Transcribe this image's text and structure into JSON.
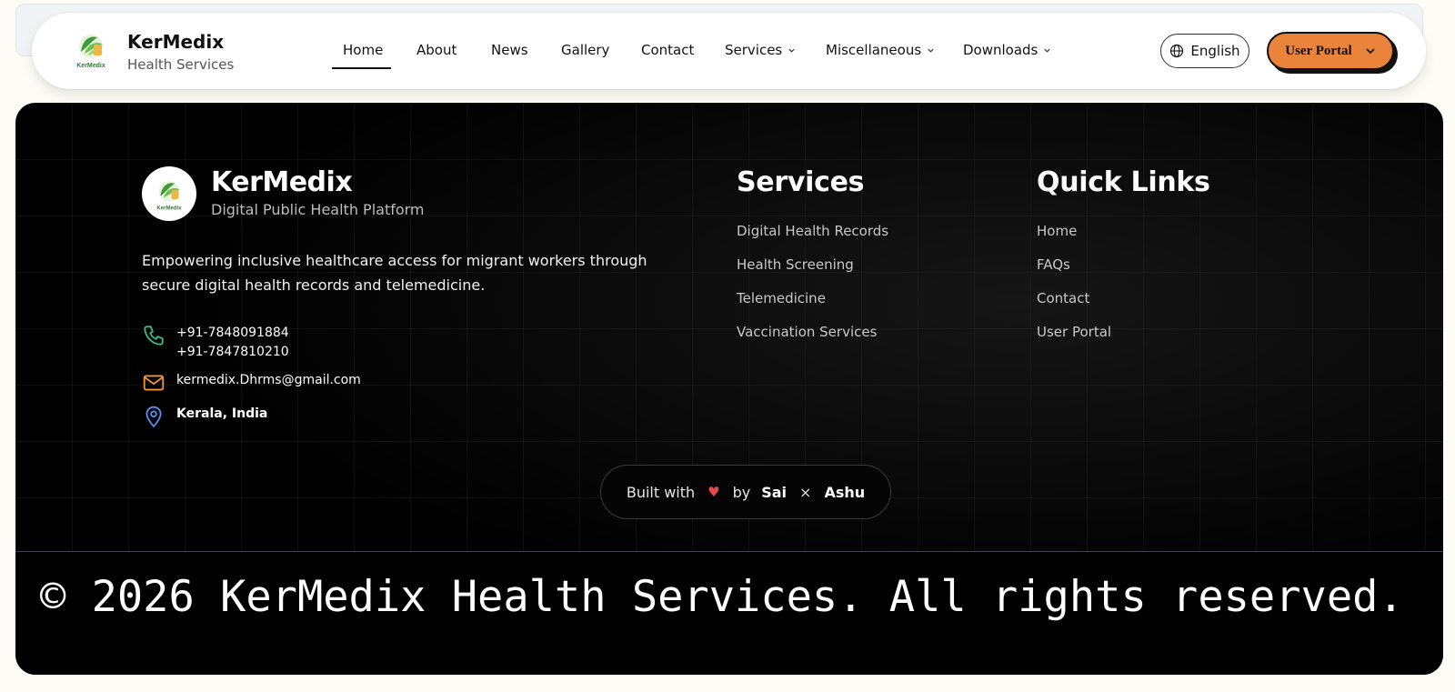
{
  "header": {
    "brand_name": "KerMedix",
    "brand_tagline": "Health Services",
    "nav": [
      {
        "label": "Home",
        "active": true
      },
      {
        "label": "About"
      },
      {
        "label": "News"
      },
      {
        "label": "Gallery"
      },
      {
        "label": "Contact"
      },
      {
        "label": "Services",
        "dropdown": true
      },
      {
        "label": "Miscellaneous",
        "dropdown": true
      },
      {
        "label": "Downloads",
        "dropdown": true
      }
    ],
    "language": "English",
    "user_portal": "User Portal"
  },
  "footer": {
    "brand_name": "KerMedix",
    "brand_tagline": "Digital Public Health Platform",
    "description": "Empowering inclusive healthcare access for migrant workers through secure digital health records and telemedicine.",
    "phone_1": "+91-7848091884",
    "phone_2": "+91-7847810210",
    "email": "kermedix.Dhrms@gmail.com",
    "location": "Kerala, India",
    "services_title": "Services",
    "services": [
      "Digital Health Records",
      "Health Screening",
      "Telemedicine",
      "Vaccination Services"
    ],
    "quick_links_title": "Quick Links",
    "quick_links": [
      "Home",
      "FAQs",
      "Contact",
      "User Portal"
    ],
    "credit": {
      "built_with": "Built with",
      "heart": "♥",
      "by": "by",
      "author_1": "Sai",
      "separator": "×",
      "author_2": "Ashu"
    },
    "copyright": "© 2026 KerMedix Health Services. All rights reserved."
  },
  "colors": {
    "accent": "#e9843a",
    "phone_icon": "#3cc28a",
    "mail_icon": "#f0953e",
    "location_icon": "#5b8ef2",
    "heart": "#e54848"
  }
}
